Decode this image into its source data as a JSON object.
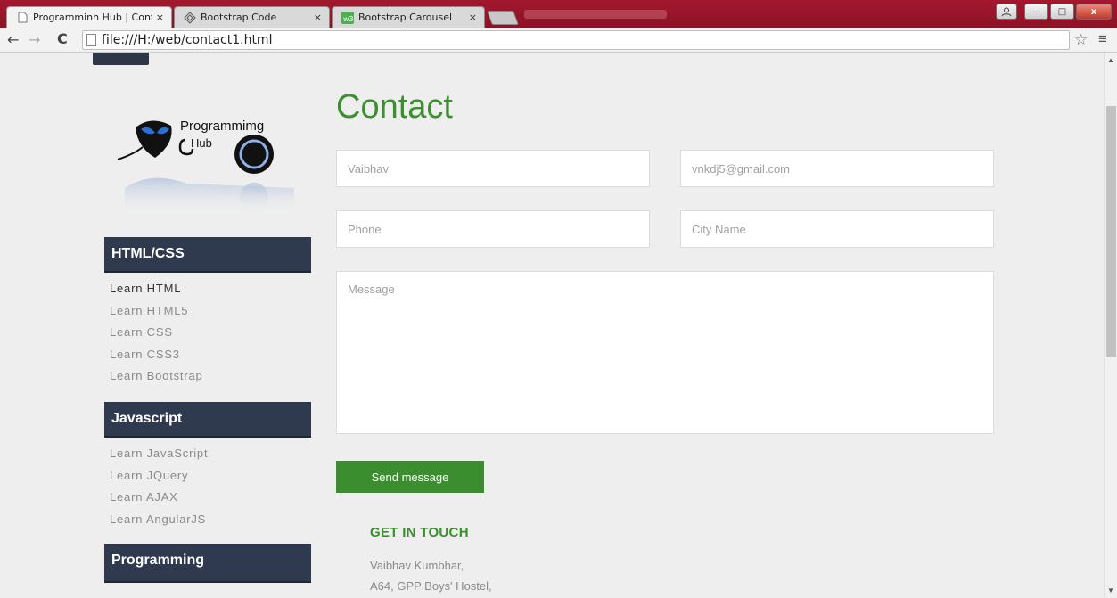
{
  "browser": {
    "tabs": [
      {
        "label": "Programminh Hub | Conta",
        "icon": "page-icon",
        "active": true
      },
      {
        "label": "Bootstrap Code",
        "icon": "bootstrap-code-icon",
        "active": false
      },
      {
        "label": "Bootstrap Carousel",
        "icon": "w3-icon",
        "active": false
      }
    ],
    "tab_close": "×",
    "url": "file:///H:/web/contact1.html",
    "window_buttons": {
      "minimize": "—",
      "maximize": "□",
      "close": "x"
    }
  },
  "sidebar": {
    "logo": {
      "line1": "Programmimg",
      "line2": "Hub"
    },
    "sections": [
      {
        "title": "HTML/CSS",
        "items": [
          {
            "label": "Learn HTML",
            "active": true
          },
          {
            "label": "Learn HTML5",
            "active": false
          },
          {
            "label": "Learn CSS",
            "active": false
          },
          {
            "label": "Learn CSS3",
            "active": false
          },
          {
            "label": "Learn Bootstrap",
            "active": false
          }
        ]
      },
      {
        "title": "Javascript",
        "items": [
          {
            "label": "Learn JavaScript",
            "active": false
          },
          {
            "label": "Learn JQuery",
            "active": false
          },
          {
            "label": "Learn AJAX",
            "active": false
          },
          {
            "label": "Learn AngularJS",
            "active": false
          }
        ]
      },
      {
        "title": "Programming",
        "items": []
      }
    ]
  },
  "contact": {
    "title": "Contact",
    "name_placeholder": "Vaibhav",
    "email_placeholder": "vnkdj5@gmail.com",
    "phone_placeholder": "Phone",
    "city_placeholder": "City Name",
    "message_placeholder": "Message",
    "send_label": "Send message",
    "touch_title": "GET IN TOUCH",
    "address_lines": [
      "Vaibhav Kumbhar,",
      "A64, GPP Boys' Hostel,"
    ]
  },
  "colors": {
    "accent_green": "#3a8e2d",
    "sidebar_header": "#2f3a4f",
    "chrome_red": "#a3182e"
  }
}
